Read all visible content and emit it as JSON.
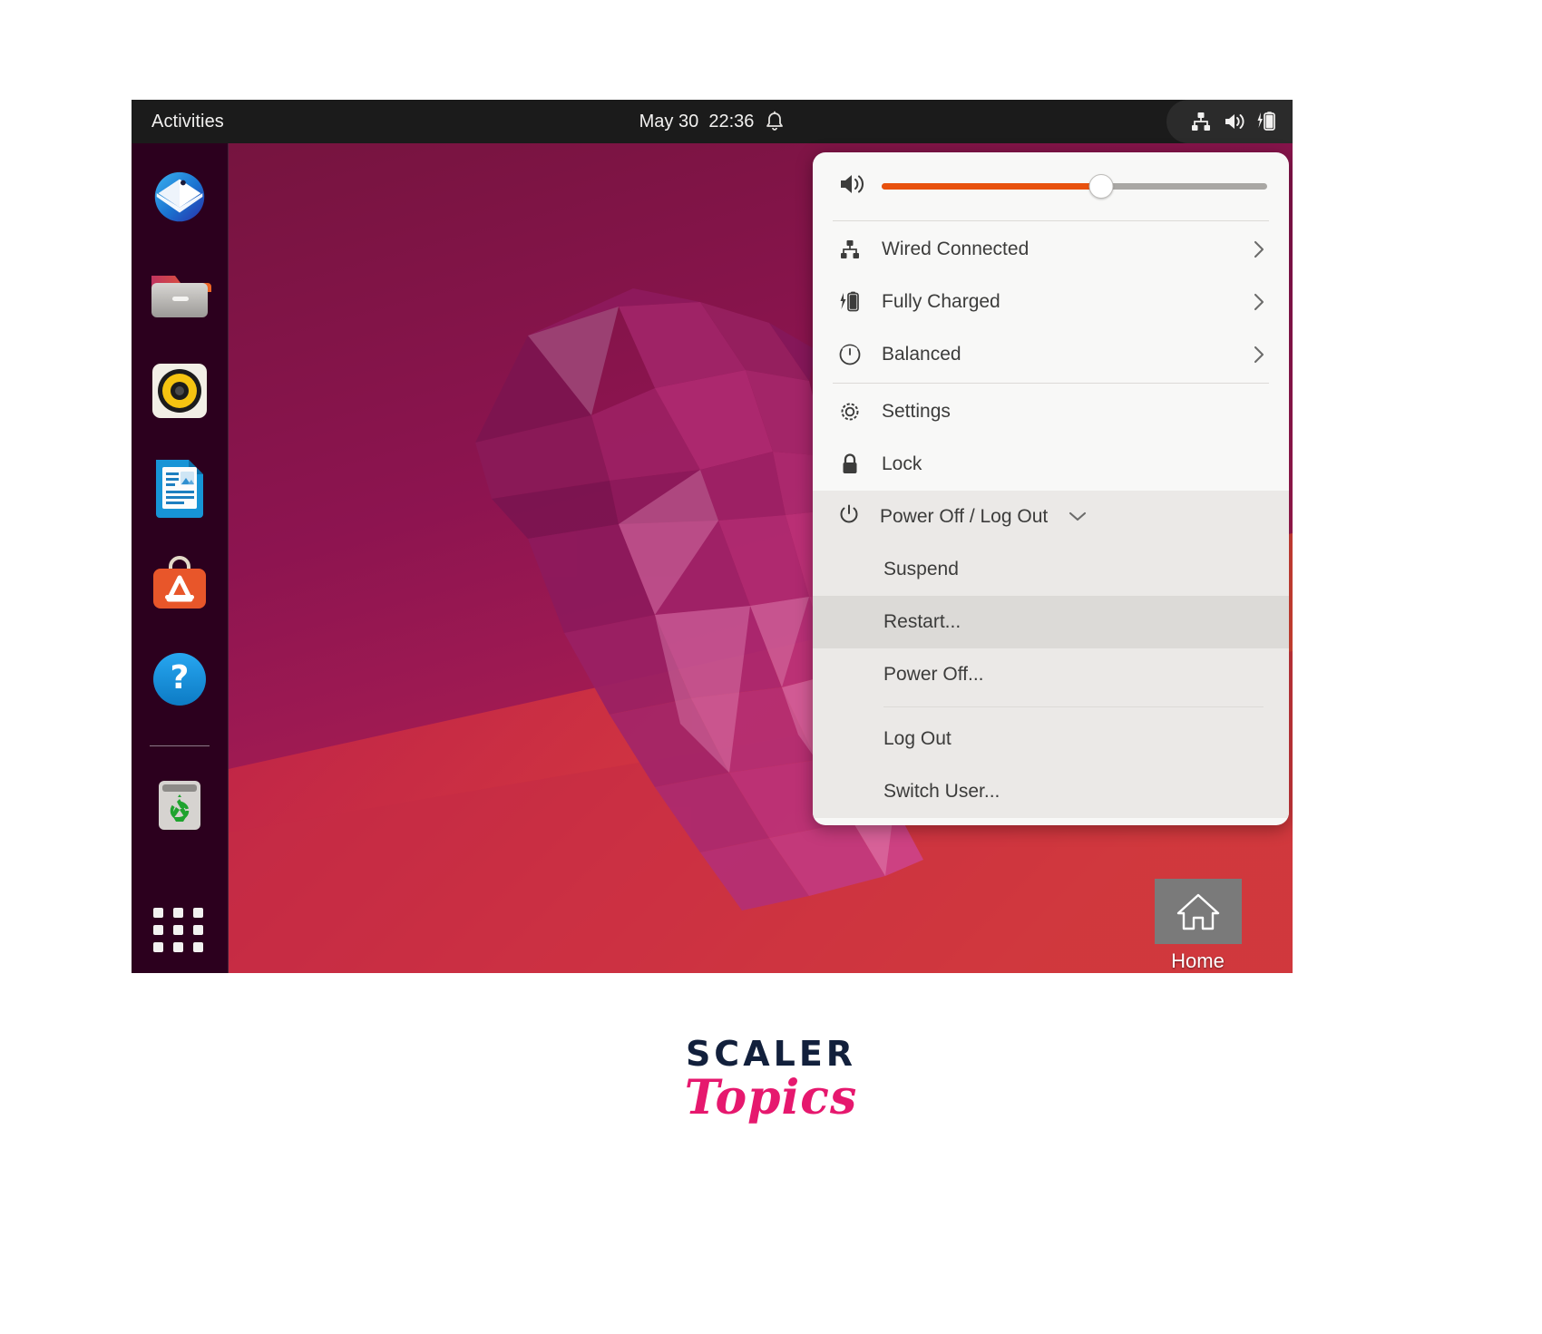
{
  "topbar": {
    "activities_label": "Activities",
    "clock": "May 30  22:36",
    "bell_icon": "bell-icon",
    "status_icons": [
      "network-wired-icon",
      "volume-icon",
      "battery-charging-icon"
    ]
  },
  "dock": {
    "items": [
      {
        "name": "thunderbird",
        "label": "Thunderbird Mail"
      },
      {
        "name": "files",
        "label": "Files"
      },
      {
        "name": "rhythmbox",
        "label": "Rhythmbox"
      },
      {
        "name": "libreoffice-writer",
        "label": "LibreOffice Writer"
      },
      {
        "name": "ubuntu-software",
        "label": "Ubuntu Software"
      },
      {
        "name": "help",
        "label": "Help"
      },
      {
        "name": "trash",
        "label": "Trash"
      }
    ],
    "app_grid_label": "Show Applications"
  },
  "desktop": {
    "home_icon_label": "Home"
  },
  "system_menu": {
    "volume": {
      "icon": "volume-high-icon",
      "value": 57
    },
    "rows": [
      {
        "icon": "network-wired-icon",
        "label": "Wired Connected",
        "chevron": "chevron-right-icon"
      },
      {
        "icon": "battery-charging-icon",
        "label": "Fully Charged",
        "chevron": "chevron-right-icon"
      },
      {
        "icon": "power-profile-icon",
        "label": "Balanced",
        "chevron": "chevron-right-icon"
      }
    ],
    "actions": [
      {
        "icon": "gear-icon",
        "label": "Settings"
      },
      {
        "icon": "lock-icon",
        "label": "Lock"
      }
    ],
    "power": {
      "icon": "power-icon",
      "label": "Power Off / Log Out",
      "chevron": "chevron-down-icon",
      "expanded": true,
      "items": [
        {
          "label": "Suspend",
          "highlighted": false
        },
        {
          "label": "Restart...",
          "highlighted": true
        },
        {
          "label": "Power Off...",
          "highlighted": false
        },
        {
          "label": "Log Out",
          "highlighted": false
        },
        {
          "label": "Switch User...",
          "highlighted": false
        }
      ]
    }
  },
  "watermark": {
    "line1": "SCALER",
    "line2": "Topics"
  },
  "colors": {
    "accent_orange": "#e8510d",
    "topbar": "#1b1b1b",
    "dock": "#2c001e",
    "menu_bg": "#f8f8f7",
    "menu_expanded_bg": "#ebe9e7",
    "menu_highlight": "#dcdad7",
    "watermark_pink": "#e6186e",
    "watermark_navy": "#12203c"
  }
}
